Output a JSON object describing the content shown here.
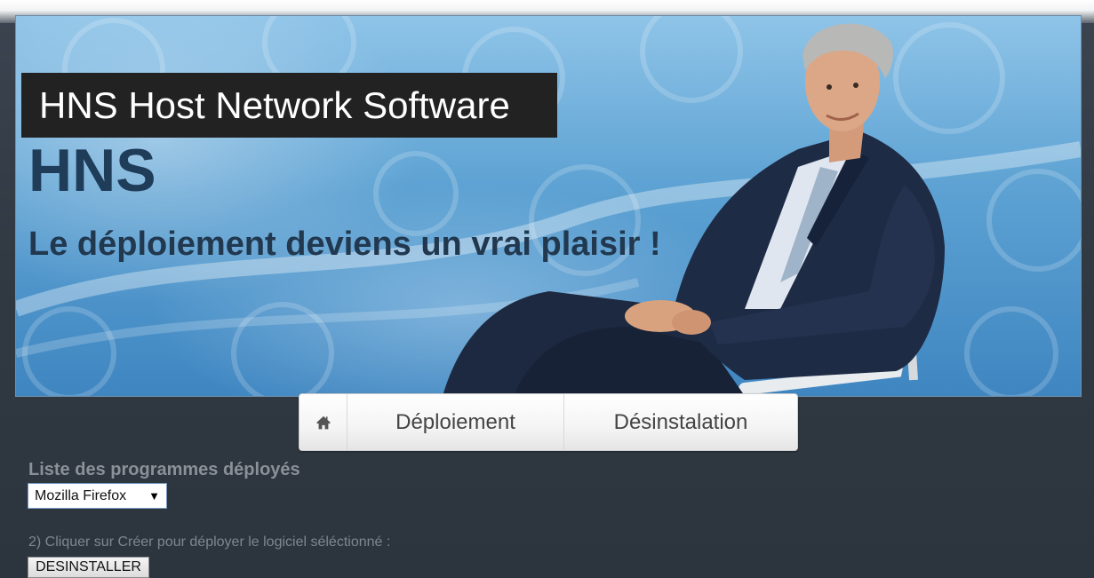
{
  "banner": {
    "title": "HNS Host Network Software",
    "brand": "HNS",
    "slogan": "Le déploiement deviens un vrai plaisir !"
  },
  "nav": {
    "home_icon": "home-icon",
    "items": [
      {
        "label": "Déploiement"
      },
      {
        "label": "Désinstalation"
      }
    ]
  },
  "form": {
    "list_label": "Liste des programmes déployés",
    "selected_program": "Mozilla Firefox",
    "instruction": "2) Cliquer sur Créer pour déployer le logiciel séléctionné :",
    "uninstall_button": "DESINSTALLER"
  },
  "colors": {
    "banner_title_bg": "#222222",
    "brand_text": "#1f3c58",
    "page_bg": "#313943"
  }
}
